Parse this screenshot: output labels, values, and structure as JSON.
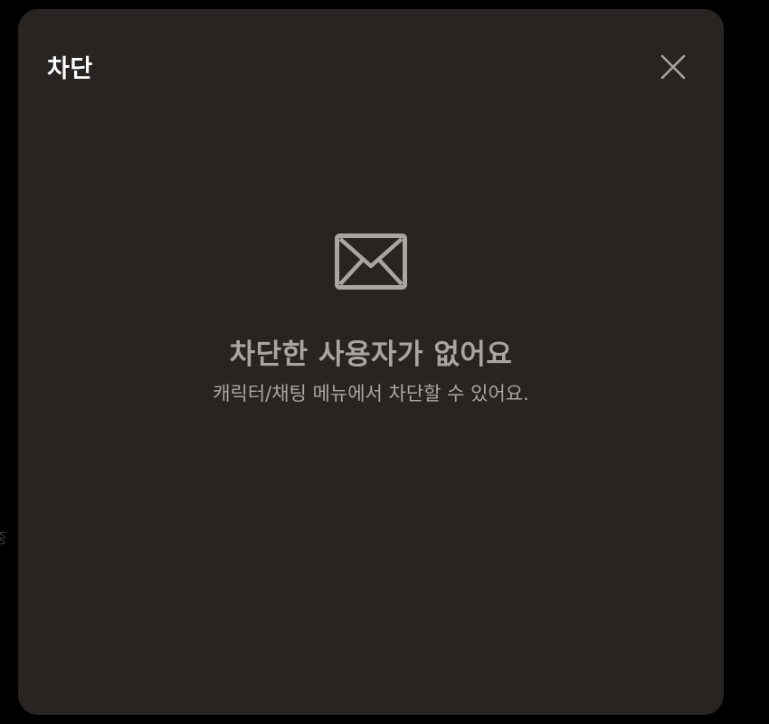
{
  "background": {
    "fragment_text": "중"
  },
  "dialog": {
    "title": "차단",
    "close_icon": "close-icon",
    "empty_state": {
      "icon": "envelope-icon",
      "title": "차단한 사용자가 없어요",
      "subtitle": "캐릭터/채팅 메뉴에서 차단할 수 있어요."
    }
  },
  "colors": {
    "page_background": "#000000",
    "dialog_background": "#272422",
    "title_text": "#ffffff",
    "muted_text": "#a9a5a2",
    "icon": "#a9a5a2"
  }
}
